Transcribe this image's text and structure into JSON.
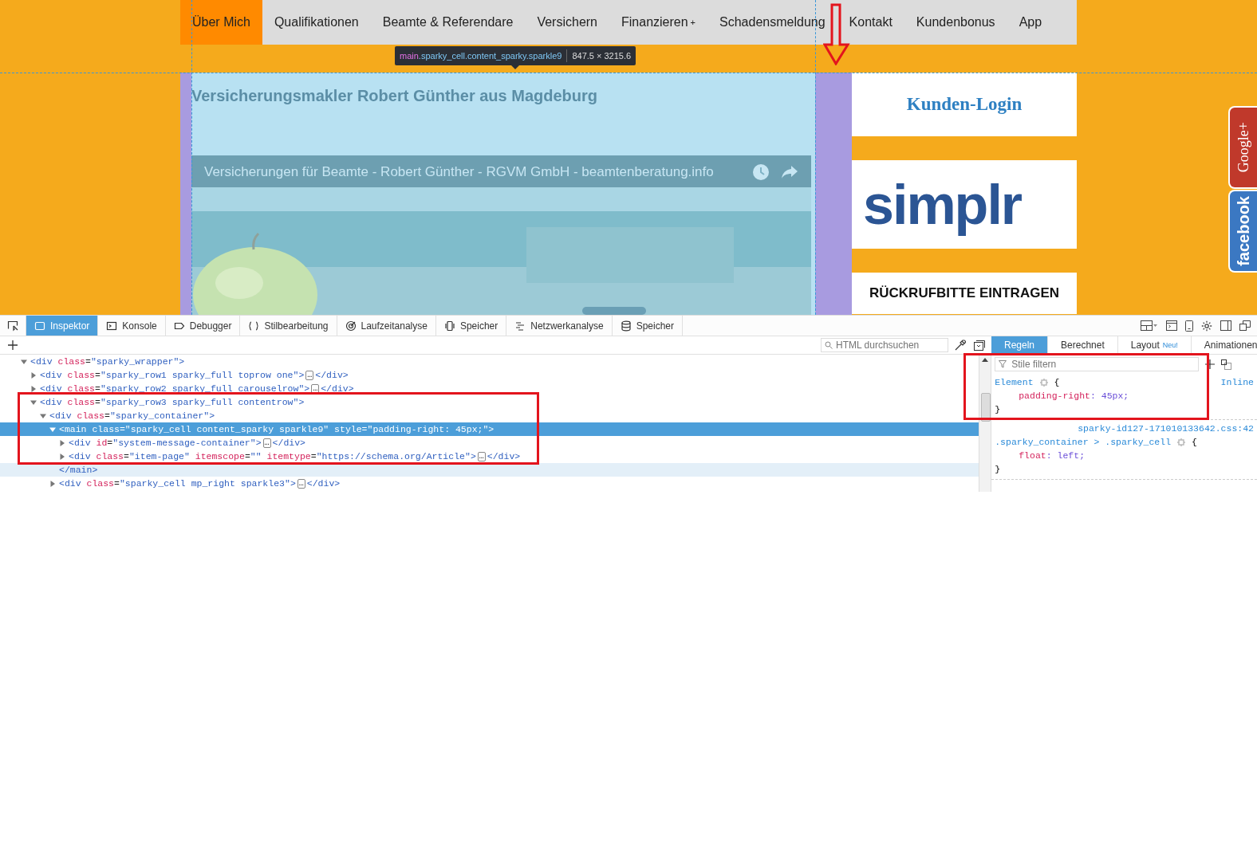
{
  "page": {
    "nav": [
      {
        "label": "Über Mich",
        "selected": true
      },
      {
        "label": "Qualifikationen",
        "selected": false
      },
      {
        "label": "Beamte & Referendare",
        "selected": false
      },
      {
        "label": "Versichern",
        "selected": false
      },
      {
        "label": "Finanzieren",
        "suffix": "+",
        "selected": false
      },
      {
        "label": "Schadensmeldung",
        "selected": false
      },
      {
        "label": "Kontakt",
        "selected": false
      },
      {
        "label": "Kundenbonus",
        "selected": false
      },
      {
        "label": "App",
        "selected": false
      }
    ],
    "heading": "Versicherungsmakler Robert Günther aus Magdeburg",
    "video": {
      "title": "Versicherungen für Beamte - Robert Günther - RGVM GmbH - beamtenberatung.info"
    },
    "sidebar": [
      {
        "kind": "login",
        "text": "Kunden-Login"
      },
      {
        "kind": "logo",
        "text": "simplr"
      },
      {
        "kind": "button",
        "text": "RÜCKRUFBITTE EINTRAGEN"
      }
    ],
    "social_tabs": [
      {
        "label": "Google+",
        "color": "#c0392b"
      },
      {
        "label": "facebook",
        "color": "#3b78c2"
      }
    ]
  },
  "inspector_tooltip": {
    "tag": "main",
    "classes": ".sparky_cell.content_sparky.sparkle9",
    "size": "847.5 × 3215.6"
  },
  "devtools": {
    "tools": [
      {
        "label": "Inspektor",
        "selected": true
      },
      {
        "label": "Konsole",
        "selected": false
      },
      {
        "label": "Debugger",
        "selected": false
      },
      {
        "label": "Stilbearbeitung",
        "selected": false
      },
      {
        "label": "Laufzeitanalyse",
        "selected": false
      },
      {
        "label": "Speicher",
        "selected": false
      },
      {
        "label": "Netzwerkanalyse",
        "selected": false
      },
      {
        "label": "Speicher",
        "selected": false
      }
    ],
    "search": {
      "placeholder": "HTML durchsuchen"
    },
    "sidebar_tabs": [
      {
        "label": "Regeln",
        "selected": true
      },
      {
        "label": "Berechnet",
        "selected": false
      },
      {
        "label": "Layout",
        "badge": "Neu!",
        "selected": false
      },
      {
        "label": "Animationen",
        "selected": false
      }
    ],
    "filter": {
      "placeholder": "Stile filtern"
    },
    "tree": [
      {
        "text": "<div class=\"sparky_wrapper\">",
        "expanded": true,
        "selected": false,
        "hovered": false,
        "children": [
          {
            "text": "<div class=\"sparky_row1 sparky_full toprow one\">",
            "more": "…",
            "end": "</div>",
            "expanded": false,
            "selected": false,
            "hovered": false
          },
          {
            "text": "<div class=\"sparky_row2 sparky_full carouselrow\">",
            "more": "…",
            "end": "</div>",
            "expanded": false,
            "selected": false,
            "hovered": false
          },
          {
            "text": "<div class=\"sparky_row3 sparky_full contentrow\">",
            "expanded": true,
            "selected": false,
            "hovered": false,
            "children": [
              {
                "text": "<div class=\"sparky_container\">",
                "expanded": true,
                "selected": false,
                "hovered": false,
                "children": [
                  {
                    "text": "<main class=\"sparky_cell content_sparky sparkle9\" style=\"padding-right: 45px;\">",
                    "expanded": true,
                    "selected": true,
                    "hovered": false,
                    "children": [
                      {
                        "text": "<div id=\"system-message-container\">",
                        "more": "…",
                        "end": "</div>",
                        "expanded": false,
                        "selected": false,
                        "hovered": false
                      },
                      {
                        "text": "<div class=\"item-page\" itemscope=\"\" itemtype=\"https://schema.org/Article\">",
                        "more": "…",
                        "end": "</div>",
                        "expanded": false,
                        "selected": false,
                        "hovered": false
                      }
                    ],
                    "close": {
                      "text": "</main>",
                      "selected": false,
                      "hovered": true
                    }
                  },
                  {
                    "text": "<div class=\"sparky_cell mp_right sparkle3\">",
                    "more": "…",
                    "end": "</div>",
                    "expanded": false,
                    "selected": false,
                    "hovered": false
                  }
                ]
              }
            ]
          }
        ]
      }
    ],
    "rules": [
      {
        "source": "Inline",
        "selector": "Element",
        "open": "{",
        "declarations": [
          "padding-right: 45px;"
        ],
        "close": "}"
      },
      {
        "source": "sparky-id127-171010133642.css:42",
        "selector": ".sparky_container > .sparky_cell",
        "open": "{",
        "declarations": [
          "float: left;"
        ],
        "close": "}"
      }
    ]
  }
}
